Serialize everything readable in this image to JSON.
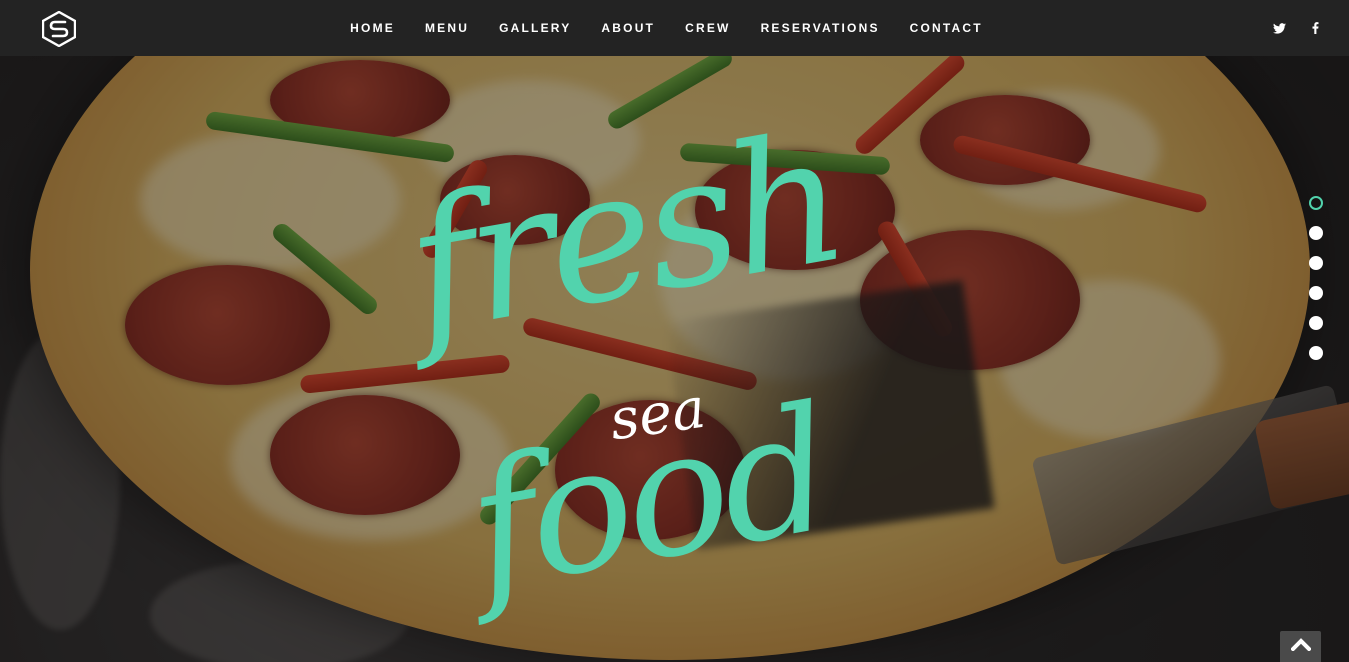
{
  "nav": {
    "items": [
      {
        "label": "HOME"
      },
      {
        "label": "MENU"
      },
      {
        "label": "GALLERY"
      },
      {
        "label": "ABOUT"
      },
      {
        "label": "CREW"
      },
      {
        "label": "RESERVATIONS"
      },
      {
        "label": "CONTACT"
      }
    ],
    "social": [
      {
        "icon": "twitter-icon"
      },
      {
        "icon": "facebook-icon"
      }
    ]
  },
  "hero": {
    "title_line1": "fresh",
    "title_middle": "sea",
    "title_line2": "food",
    "slides_total": 6,
    "active_slide": 1
  },
  "colors": {
    "accent": "#52d3ad",
    "navbar_bg": "#232323",
    "text": "#ffffff"
  },
  "back_to_top": {
    "icon": "chevron-up-icon"
  }
}
